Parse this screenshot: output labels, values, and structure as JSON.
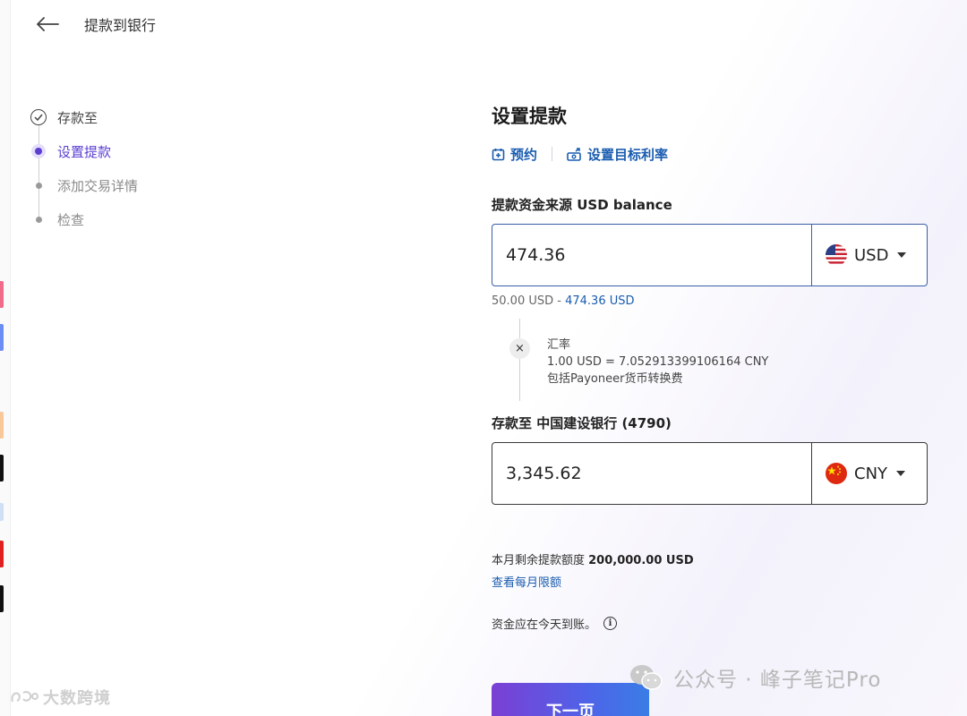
{
  "header": {
    "title": "提款到银行"
  },
  "steps": [
    {
      "label": "存款至",
      "state": "done"
    },
    {
      "label": "设置提款",
      "state": "active"
    },
    {
      "label": "添加交易详情",
      "state": "pending"
    },
    {
      "label": "检查",
      "state": "pending"
    }
  ],
  "form": {
    "title": "设置提款",
    "links": {
      "schedule": "预约",
      "target_rate": "设置目标利率"
    },
    "source": {
      "label": "提款资金来源 USD balance",
      "amount": "474.36",
      "currency": "USD",
      "range_min": "50.00 USD",
      "range_sep": " - ",
      "range_max": "474.36 USD"
    },
    "rate": {
      "x": "×",
      "title": "汇率",
      "value": "1.00 USD = 7.052913399106164 CNY",
      "note": "包括Payoneer货币转换费"
    },
    "dest": {
      "label": "存款至 中国建设银行 (4790)",
      "amount": "3,345.62",
      "currency": "CNY"
    },
    "limit": {
      "prefix": "本月剩余提款额度 ",
      "amount": "200,000.00 USD",
      "link": "查看每月限额"
    },
    "arrive": "资金应在今天到账。",
    "info_glyph": "i",
    "next_button": "下一页"
  },
  "watermarks": {
    "left": "大数跨境",
    "right": "公众号 · 峰子笔记Pro"
  },
  "colors": {
    "accent": "#5b3fd1",
    "link": "#1a5cb0",
    "button_start": "#7b3fd4",
    "button_end": "#3a7de6"
  }
}
